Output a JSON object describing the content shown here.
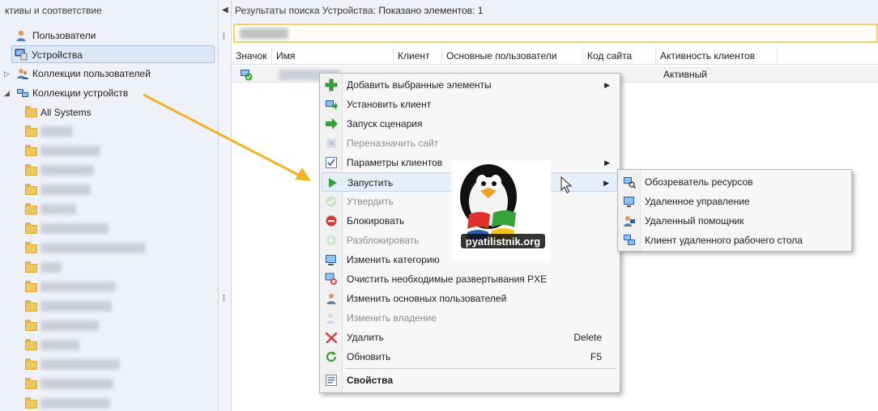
{
  "left_pane": {
    "header": "ктивы и соответствие",
    "items": [
      {
        "label": "Пользователи",
        "icon": "user-icon"
      },
      {
        "label": "Устройства",
        "icon": "devices-icon",
        "selected": true
      },
      {
        "label": "Коллекции пользователей",
        "icon": "user-collection-icon"
      },
      {
        "label": "Коллекции устройств",
        "icon": "device-collection-icon"
      }
    ],
    "folders": [
      {
        "label": "All Systems"
      }
    ]
  },
  "results": {
    "title": "Результаты поиска Устройства:",
    "count_text": "Показано элементов: 1"
  },
  "grid": {
    "columns": [
      "Значок",
      "Имя",
      "Клиент",
      "Основные пользователи",
      "Код сайта",
      "Активность клиентов"
    ],
    "row": {
      "activity": "Активный"
    }
  },
  "context_menu": {
    "items": [
      {
        "label": "Добавить выбранные элементы",
        "icon": "add-icon",
        "submenu": true
      },
      {
        "label": "Установить клиент",
        "icon": "install-client-icon"
      },
      {
        "label": "Запуск сценария",
        "icon": "run-script-icon"
      },
      {
        "label": "Переназначить сайт",
        "icon": "reassign-site-icon",
        "disabled": true
      },
      {
        "label": "Параметры клиентов",
        "icon": "client-settings-icon",
        "submenu": true
      },
      {
        "label": "Запустить",
        "icon": "play-icon",
        "submenu": true,
        "highlighted": true
      },
      {
        "label": "Утвердить",
        "icon": "approve-icon",
        "disabled": true
      },
      {
        "label": "Блокировать",
        "icon": "block-icon"
      },
      {
        "label": "Разблокировать",
        "icon": "unblock-icon",
        "disabled": true
      },
      {
        "label": "Изменить категорию",
        "icon": "category-icon"
      },
      {
        "label": "Очистить необходимые развертывания PXE",
        "icon": "pxe-clear-icon"
      },
      {
        "label": "Изменить основных пользователей",
        "icon": "primary-users-icon"
      },
      {
        "label": "Изменить владение",
        "icon": "ownership-icon",
        "disabled": true
      },
      {
        "label": "Удалить",
        "icon": "delete-icon",
        "shortcut": "Delete"
      },
      {
        "label": "Обновить",
        "icon": "refresh-icon",
        "shortcut": "F5"
      },
      {
        "label": "Свойства",
        "icon": "properties-icon",
        "bold": true
      }
    ]
  },
  "submenu": {
    "items": [
      {
        "label": "Обозреватель ресурсов",
        "icon": "resource-explorer-icon"
      },
      {
        "label": "Удаленное управление",
        "icon": "remote-control-icon"
      },
      {
        "label": "Удаленный помощник",
        "icon": "remote-assistance-icon"
      },
      {
        "label": "Клиент удаленного рабочего стола",
        "icon": "remote-desktop-icon"
      }
    ]
  },
  "watermark": {
    "text": "pyatilistnik.org"
  },
  "colors": {
    "accent_arrow": "#f0b429",
    "selection": "#dde8f6",
    "menu_hover": "#e5eef9",
    "search_border": "#f5cf6c"
  }
}
